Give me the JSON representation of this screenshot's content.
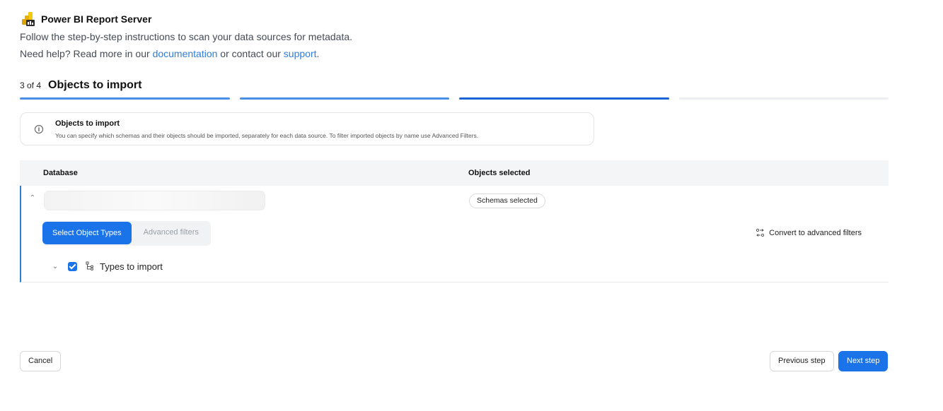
{
  "header": {
    "title": "Power BI Report Server",
    "logo_icon": "power-bi-icon",
    "logo_color": "#f2c811"
  },
  "intro": {
    "line1": "Follow the step-by-step instructions to scan your data sources for metadata.",
    "help_prefix": "Need help? Read more in our ",
    "documentation_link": "documentation",
    "help_middle": " or contact our ",
    "support_link": "support",
    "help_suffix": "."
  },
  "step": {
    "count": "3 of 4",
    "title": "Objects to import",
    "current": 3,
    "total": 4
  },
  "info": {
    "icon": "info-icon",
    "title": "Objects to import",
    "description": "You can specify which schemas and their objects should be imported, separately for each data source. To filter imported objects by name use Advanced Filters."
  },
  "table": {
    "columns": [
      "Database",
      "Objects selected"
    ],
    "rows": [
      {
        "database": "",
        "objects_selected": "Schemas selected"
      }
    ]
  },
  "filters": {
    "tabs": [
      "Select Object Types",
      "Advanced filters"
    ],
    "active_tab": "Select Object Types",
    "convert_label": "Convert to advanced filters"
  },
  "types": {
    "label": "Types to import",
    "checked": true
  },
  "footer": {
    "cancel": "Cancel",
    "previous": "Previous step",
    "next": "Next step"
  },
  "colors": {
    "accent": "#1a73e8",
    "link": "#2f7ed8"
  }
}
